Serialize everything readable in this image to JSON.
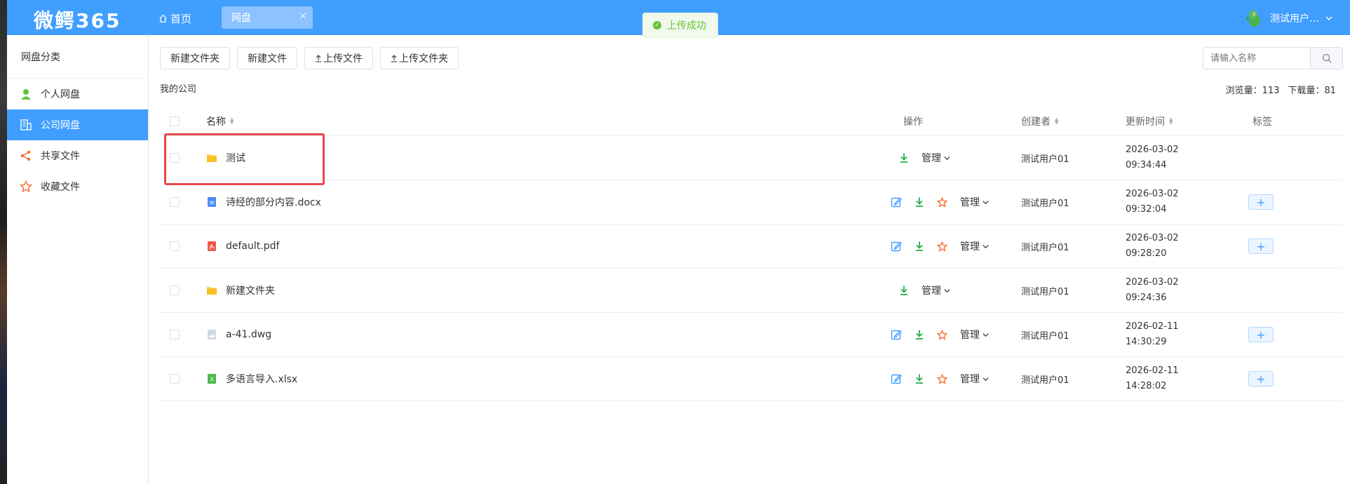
{
  "header": {
    "logo": "微鳄365",
    "home_label": "首页",
    "active_tab": "网盘",
    "tab_close": "×",
    "user_name": "测试用户…"
  },
  "toast": {
    "text": "上传成功"
  },
  "sidebar": {
    "title": "网盘分类",
    "items": [
      {
        "label": "个人网盘",
        "icon": "user-icon"
      },
      {
        "label": "公司网盘",
        "icon": "building-icon",
        "active": true
      },
      {
        "label": "共享文件",
        "icon": "share-icon"
      },
      {
        "label": "收藏文件",
        "icon": "star-icon"
      }
    ]
  },
  "toolbar": {
    "new_folder": "新建文件夹",
    "new_file": "新建文件",
    "upload_file": "上传文件",
    "upload_folder": "上传文件夹"
  },
  "breadcrumb": "我的公司",
  "search": {
    "placeholder": "请输入名称"
  },
  "stats": {
    "views_label": "浏览量：",
    "views": "113",
    "downloads_label": "下载量：",
    "downloads": "81"
  },
  "table": {
    "headers": {
      "name": "名称",
      "ops": "操作",
      "creator": "创建者",
      "updated": "更新时间",
      "tags": "标签"
    },
    "manage_label": "管理",
    "rows": [
      {
        "name": "测试",
        "type": "folder",
        "creator": "测试用户01",
        "date": "2026-03-02",
        "time": "09:34:44"
      },
      {
        "name": "诗经的部分内容.docx",
        "type": "word",
        "creator": "测试用户01",
        "date": "2026-03-02",
        "time": "09:32:04"
      },
      {
        "name": "default.pdf",
        "type": "pdf",
        "creator": "测试用户01",
        "date": "2026-03-02",
        "time": "09:28:20"
      },
      {
        "name": "新建文件夹",
        "type": "folder",
        "creator": "测试用户01",
        "date": "2026-03-02",
        "time": "09:24:36"
      },
      {
        "name": "a-41.dwg",
        "type": "dwg",
        "creator": "测试用户01",
        "date": "2026-02-11",
        "time": "14:30:29"
      },
      {
        "name": "多语言导入.xlsx",
        "type": "excel",
        "creator": "测试用户01",
        "date": "2026-02-11",
        "time": "14:28:02"
      }
    ]
  },
  "colors": {
    "primary": "#409eff",
    "success": "#67c23a",
    "highlight": "#e8464a"
  }
}
